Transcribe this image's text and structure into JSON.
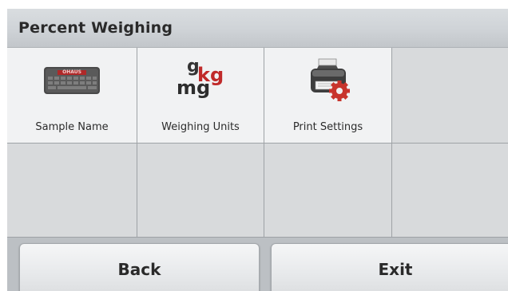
{
  "header": {
    "title": "Percent Weighing"
  },
  "grid": {
    "items": [
      {
        "label": "Sample Name",
        "icon": "keyboard-icon"
      },
      {
        "label": "Weighing Units",
        "icon": "units-icon"
      },
      {
        "label": "Print Settings",
        "icon": "printer-settings-icon"
      }
    ]
  },
  "units_icon": {
    "g": "g",
    "kg": "kg",
    "mg": "mg"
  },
  "keyboard_logo": "OHAUS",
  "buttons": {
    "back": "Back",
    "exit": "Exit"
  },
  "colors": {
    "accent_red": "#c02a2a",
    "title_bar": "#d4d8dc",
    "button_face": "#eceef0"
  }
}
